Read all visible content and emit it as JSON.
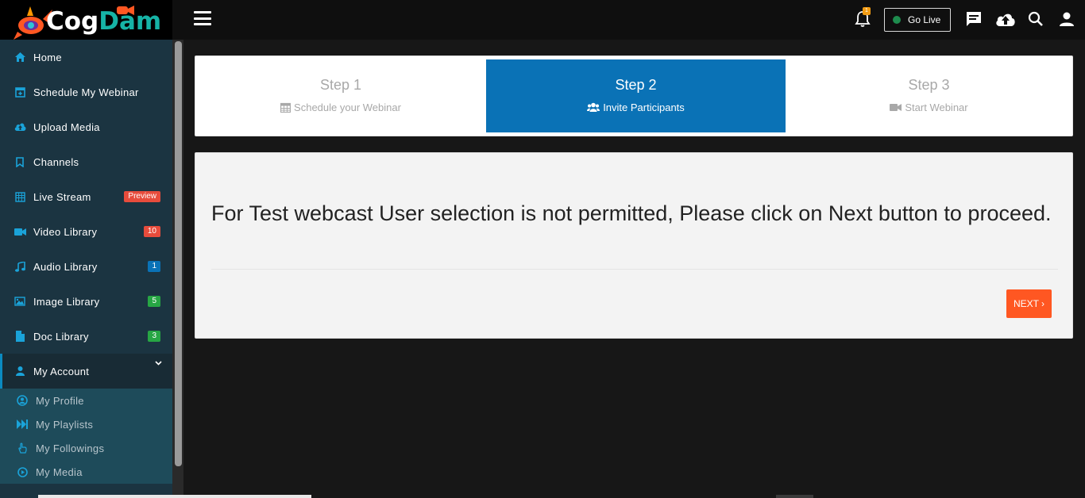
{
  "brand": {
    "part1": "Cog",
    "part2": "Dam"
  },
  "topbar": {
    "notification_count": "1",
    "golive_label": "Go Live",
    "icons": [
      "menu-icon",
      "bell-icon",
      "chat-icon",
      "cloud-upload-icon",
      "search-icon",
      "user-icon"
    ]
  },
  "sidebar": {
    "items": [
      {
        "label": "Home",
        "icon": "home-icon"
      },
      {
        "label": "Schedule My Webinar",
        "icon": "calendar-plus-icon"
      },
      {
        "label": "Upload Media",
        "icon": "cloud-upload-icon"
      },
      {
        "label": "Channels",
        "icon": "bookmark-icon"
      },
      {
        "label": "Live Stream",
        "icon": "calendar-grid-icon",
        "badge": "Preview",
        "badge_color": "#e74c3c"
      },
      {
        "label": "Video Library",
        "icon": "video-camera-icon",
        "badge": "10",
        "badge_color": "#e74c3c"
      },
      {
        "label": "Audio Library",
        "icon": "music-note-icon",
        "badge": "1",
        "badge_color": "#0a72b6"
      },
      {
        "label": "Image Library",
        "icon": "image-icon",
        "badge": "5",
        "badge_color": "#27a644"
      },
      {
        "label": "Doc Library",
        "icon": "document-icon",
        "badge": "3",
        "badge_color": "#27a644"
      },
      {
        "label": "My Account",
        "icon": "user-icon"
      }
    ],
    "submenu": [
      {
        "label": "My Profile",
        "icon": "profile-circle-icon"
      },
      {
        "label": "My Playlists",
        "icon": "skip-forward-icon"
      },
      {
        "label": "My Followings",
        "icon": "hand-pointer-icon"
      },
      {
        "label": "My Media",
        "icon": "play-circle-icon"
      }
    ]
  },
  "steps": [
    {
      "title": "Step 1",
      "subtitle": "Schedule your Webinar",
      "icon": "calendar-icon",
      "state": "inactive"
    },
    {
      "title": "Step 2",
      "subtitle": "Invite Participants",
      "icon": "users-icon",
      "state": "active"
    },
    {
      "title": "Step 3",
      "subtitle": "Start Webinar",
      "icon": "video-camera-icon",
      "state": "inactive"
    }
  ],
  "panel": {
    "message": "For Test webcast User selection is not permitted, Please click on Next button to proceed.",
    "next_label": "NEXT ›"
  },
  "colors": {
    "accent": "#0a72b6",
    "next_button": "#ff5722",
    "sidebar_bg": "#1b3441",
    "submenu_bg": "#1e4b5a",
    "logo_teal": "#16b3a6"
  }
}
